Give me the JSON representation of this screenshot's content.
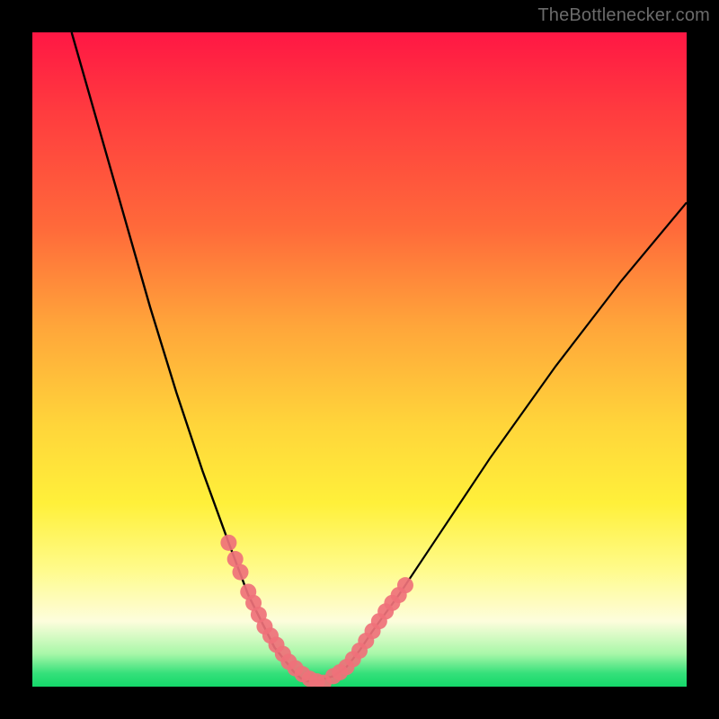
{
  "watermark": "TheBottlenecker.com",
  "colors": {
    "background": "#000000",
    "gradient_top": "#ff1744",
    "gradient_mid1": "#ff6a3a",
    "gradient_mid2": "#ffd53a",
    "gradient_low": "#fdfddc",
    "gradient_bottom": "#15d86a",
    "curve": "#000000",
    "marker": "#ef7179",
    "watermark_text": "#6b6b6b"
  },
  "chart_data": {
    "type": "line",
    "title": "",
    "xlabel": "",
    "ylabel": "",
    "xlim": [
      0,
      100
    ],
    "ylim": [
      0,
      100
    ],
    "grid": false,
    "legend": false,
    "series": [
      {
        "name": "curve-left",
        "x": [
          6,
          10,
          14,
          18,
          22,
          26,
          30,
          33,
          35,
          37,
          39,
          40,
          41,
          42
        ],
        "y": [
          100,
          86,
          72,
          58,
          45,
          33,
          22,
          14,
          10,
          6,
          3.5,
          2.2,
          1.3,
          0.8
        ]
      },
      {
        "name": "curve-right",
        "x": [
          42,
          44,
          46,
          48,
          50,
          52,
          56,
          62,
          70,
          80,
          90,
          100
        ],
        "y": [
          0.8,
          1.0,
          1.6,
          3.0,
          5.5,
          8.5,
          14,
          23,
          35,
          49,
          62,
          74
        ]
      },
      {
        "name": "markers-left",
        "x": [
          30.0,
          31.0,
          31.8,
          33.0,
          33.8,
          34.6,
          35.5,
          36.4,
          37.3,
          38.3,
          39.2,
          40.2,
          41.3,
          42.4,
          43.5,
          44.5
        ],
        "y": [
          22.0,
          19.5,
          17.5,
          14.5,
          12.8,
          11.0,
          9.2,
          7.8,
          6.4,
          5.0,
          3.8,
          2.8,
          1.9,
          1.2,
          0.8,
          0.6
        ]
      },
      {
        "name": "markers-right",
        "x": [
          46.0,
          47.0,
          48.0,
          49.0,
          50.0,
          51.0,
          52.0,
          53.0,
          54.0,
          55.0,
          56.0,
          57.0
        ],
        "y": [
          1.6,
          2.2,
          3.0,
          4.2,
          5.5,
          7.0,
          8.5,
          10.0,
          11.5,
          12.8,
          14.0,
          15.5
        ]
      }
    ]
  }
}
